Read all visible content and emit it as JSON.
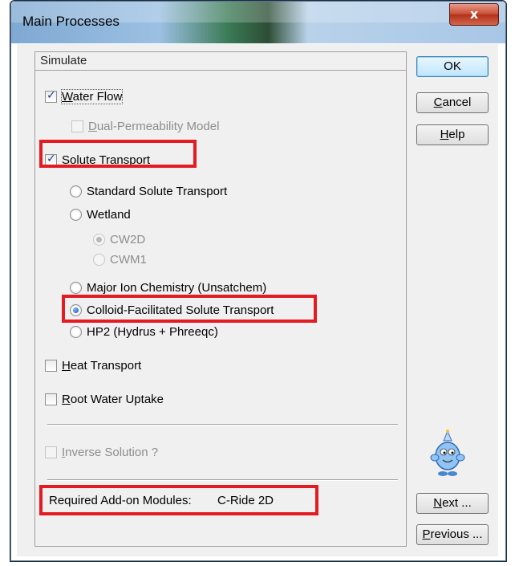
{
  "window": {
    "title": "Main Processes",
    "close_label": "x"
  },
  "group": {
    "title": "Simulate",
    "water_flow": {
      "label": "Water Flow",
      "checked": true
    },
    "dual_perm": {
      "label": "Dual-Permeability Model",
      "checked": false,
      "enabled": false
    },
    "solute_transport": {
      "label": "Solute Transport",
      "checked": true
    },
    "radios": {
      "standard": "Standard Solute Transport",
      "wetland": "Wetland",
      "cw2d": "CW2D",
      "cwm1": "CWM1",
      "major_ion": "Major Ion Chemistry (Unsatchem)",
      "colloid": "Colloid-Facilitated Solute Transport",
      "hp2": "HP2 (Hydrus + Phreeqc)",
      "selected": "colloid"
    },
    "heat_transport": {
      "label": "Heat Transport",
      "checked": false
    },
    "root_water": {
      "label": "Root Water Uptake",
      "checked": false
    },
    "inverse": {
      "label": "Inverse Solution ?",
      "checked": false,
      "enabled": false
    },
    "addon": {
      "label": "Required Add-on Modules:",
      "value": "C-Ride 2D"
    }
  },
  "buttons": {
    "ok": "OK",
    "cancel": "Cancel",
    "help": "Help",
    "next": "Next ...",
    "previous": "Previous ..."
  },
  "colors": {
    "highlight": "#e31b23",
    "dialog_bg": "#f0f0f0"
  }
}
